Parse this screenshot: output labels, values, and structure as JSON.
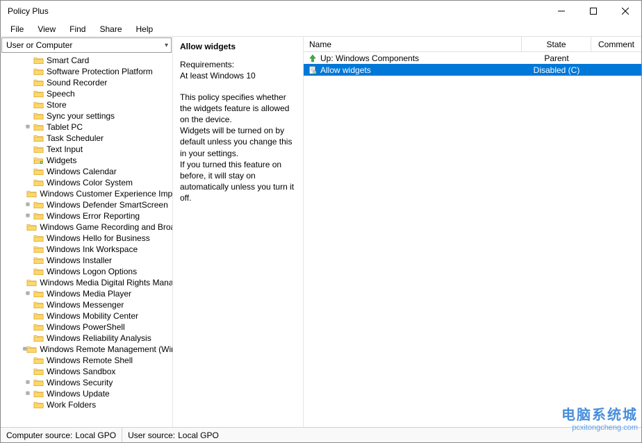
{
  "window": {
    "title": "Policy Plus"
  },
  "menu": {
    "items": [
      "File",
      "View",
      "Find",
      "Share",
      "Help"
    ]
  },
  "selector": {
    "label": "User or Computer"
  },
  "tree": {
    "base_indent": 30,
    "items": [
      {
        "label": "Smart Card",
        "expander": "",
        "indent": 0,
        "selected": false
      },
      {
        "label": "Software Protection Platform",
        "expander": "",
        "indent": 0,
        "selected": false
      },
      {
        "label": "Sound Recorder",
        "expander": "",
        "indent": 0,
        "selected": false
      },
      {
        "label": "Speech",
        "expander": "",
        "indent": 0,
        "selected": false
      },
      {
        "label": "Store",
        "expander": "",
        "indent": 0,
        "selected": false
      },
      {
        "label": "Sync your settings",
        "expander": "",
        "indent": 0,
        "selected": false
      },
      {
        "label": "Tablet PC",
        "expander": "+",
        "indent": 0,
        "selected": false
      },
      {
        "label": "Task Scheduler",
        "expander": "",
        "indent": 0,
        "selected": false
      },
      {
        "label": "Text Input",
        "expander": "",
        "indent": 0,
        "selected": false
      },
      {
        "label": "Widgets",
        "expander": "",
        "indent": 0,
        "selected": true
      },
      {
        "label": "Windows Calendar",
        "expander": "",
        "indent": 0,
        "selected": false
      },
      {
        "label": "Windows Color System",
        "expander": "",
        "indent": 0,
        "selected": false
      },
      {
        "label": "Windows Customer Experience Improvement Program",
        "expander": "",
        "indent": 0,
        "selected": false
      },
      {
        "label": "Windows Defender SmartScreen",
        "expander": "+",
        "indent": 0,
        "selected": false
      },
      {
        "label": "Windows Error Reporting",
        "expander": "+",
        "indent": 0,
        "selected": false
      },
      {
        "label": "Windows Game Recording and Broadcasting",
        "expander": "",
        "indent": 0,
        "selected": false
      },
      {
        "label": "Windows Hello for Business",
        "expander": "",
        "indent": 0,
        "selected": false
      },
      {
        "label": "Windows Ink Workspace",
        "expander": "",
        "indent": 0,
        "selected": false
      },
      {
        "label": "Windows Installer",
        "expander": "",
        "indent": 0,
        "selected": false
      },
      {
        "label": "Windows Logon Options",
        "expander": "",
        "indent": 0,
        "selected": false
      },
      {
        "label": "Windows Media Digital Rights Management",
        "expander": "",
        "indent": 0,
        "selected": false
      },
      {
        "label": "Windows Media Player",
        "expander": "+",
        "indent": 0,
        "selected": false
      },
      {
        "label": "Windows Messenger",
        "expander": "",
        "indent": 0,
        "selected": false
      },
      {
        "label": "Windows Mobility Center",
        "expander": "",
        "indent": 0,
        "selected": false
      },
      {
        "label": "Windows PowerShell",
        "expander": "",
        "indent": 0,
        "selected": false
      },
      {
        "label": "Windows Reliability Analysis",
        "expander": "",
        "indent": 0,
        "selected": false
      },
      {
        "label": "Windows Remote Management (WinRM)",
        "expander": "+",
        "indent": 0,
        "selected": false
      },
      {
        "label": "Windows Remote Shell",
        "expander": "",
        "indent": 0,
        "selected": false
      },
      {
        "label": "Windows Sandbox",
        "expander": "",
        "indent": 0,
        "selected": false
      },
      {
        "label": "Windows Security",
        "expander": "+",
        "indent": 0,
        "selected": false
      },
      {
        "label": "Windows Update",
        "expander": "+",
        "indent": 0,
        "selected": false
      },
      {
        "label": "Work Folders",
        "expander": "",
        "indent": 0,
        "selected": false
      }
    ]
  },
  "detail": {
    "title": "Allow widgets",
    "req_label": "Requirements:",
    "req_value": "At least Windows 10",
    "description": "This policy specifies whether the widgets feature is allowed on the device.\nWidgets will be turned on by default unless you change this in your settings.\nIf you turned this feature on before, it will stay on automatically unless you turn it off."
  },
  "list": {
    "columns": {
      "name": "Name",
      "state": "State",
      "comment": "Comment"
    },
    "rows": [
      {
        "icon": "up",
        "name": "Up: Windows Components",
        "state": "Parent",
        "selected": false
      },
      {
        "icon": "policy",
        "name": "Allow widgets",
        "state": "Disabled (C)",
        "selected": true
      }
    ]
  },
  "status": {
    "computer_label": "Computer source:",
    "computer_value": "Local GPO",
    "user_label": "User source:",
    "user_value": "Local GPO"
  },
  "watermark": {
    "main": "电脑系统城",
    "sub": "pcxitongcheng.com"
  }
}
